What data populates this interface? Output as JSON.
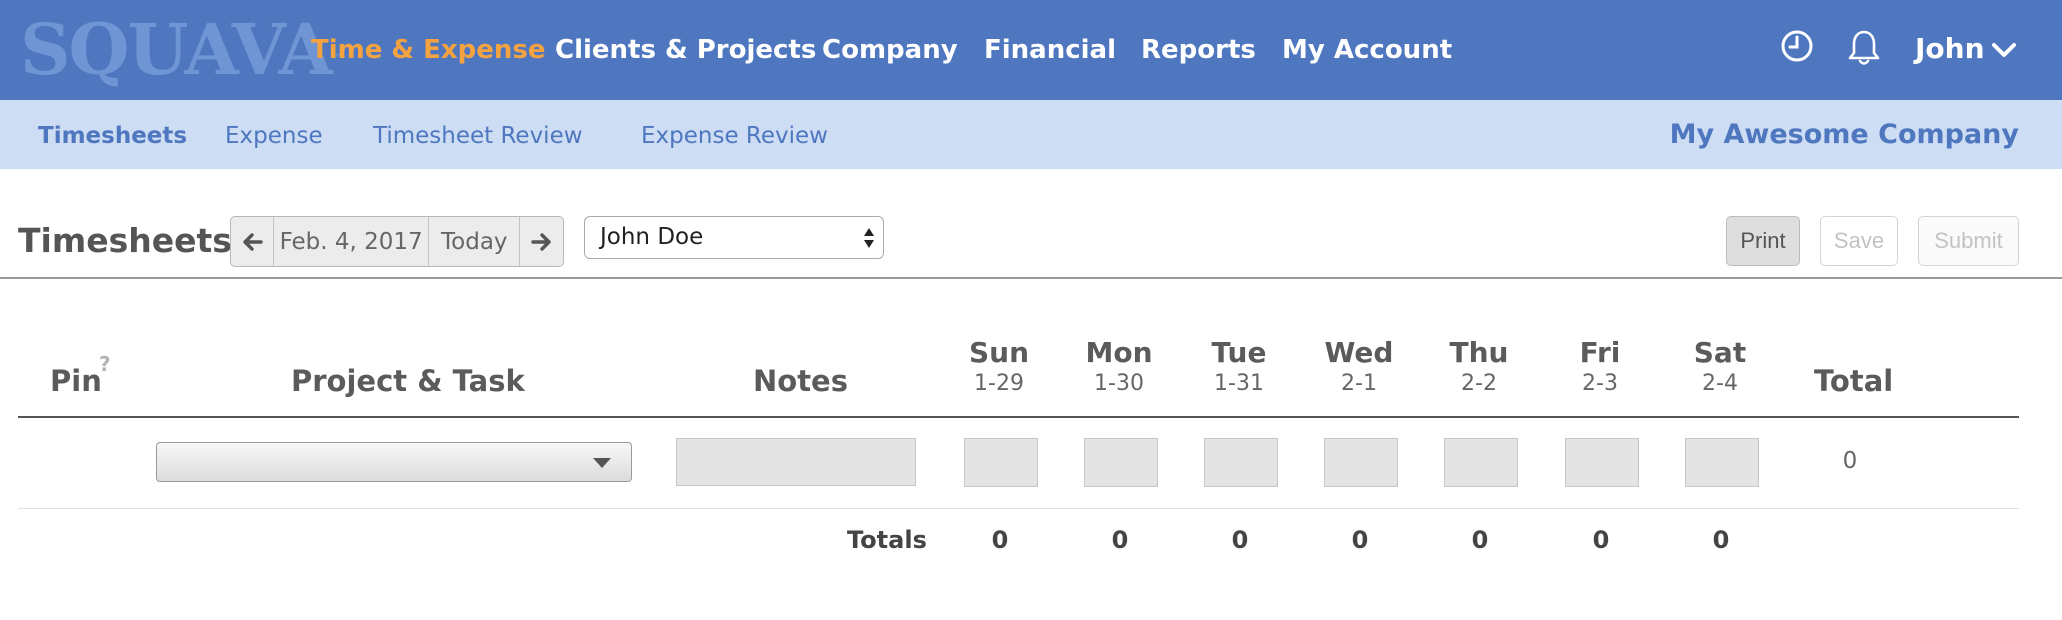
{
  "header": {
    "logo_text": "SQUAVA",
    "logo_tm": "™",
    "nav": [
      {
        "label": "Time & Expense",
        "active": true
      },
      {
        "label": "Clients & Projects"
      },
      {
        "label": "Company"
      },
      {
        "label": "Financial"
      },
      {
        "label": "Reports"
      },
      {
        "label": "My Account"
      }
    ],
    "icons": [
      "clock-icon",
      "bell-icon"
    ],
    "user": "John",
    "accent_color": "#f5a340",
    "bar_color": "#4f77c0"
  },
  "subnav": {
    "items": [
      {
        "label": "Timesheets",
        "active": true
      },
      {
        "label": "Expense"
      },
      {
        "label": "Timesheet Review"
      },
      {
        "label": "Expense Review"
      }
    ],
    "company": "My Awesome Company",
    "bar_color": "#cdddf3"
  },
  "toolbar": {
    "title": "Timesheets",
    "date": "Feb. 4, 2017",
    "today_label": "Today",
    "employee": "John Doe",
    "print_label": "Print",
    "save_label": "Save",
    "submit_label": "Submit"
  },
  "table": {
    "headers": {
      "pin": "Pin",
      "pin_help": "?",
      "project": "Project & Task",
      "notes": "Notes",
      "total": "Total"
    },
    "days": [
      {
        "name": "Sun",
        "date": "1-29"
      },
      {
        "name": "Mon",
        "date": "1-30"
      },
      {
        "name": "Tue",
        "date": "1-31"
      },
      {
        "name": "Wed",
        "date": "2-1"
      },
      {
        "name": "Thu",
        "date": "2-2"
      },
      {
        "name": "Fri",
        "date": "2-3"
      },
      {
        "name": "Sat",
        "date": "2-4"
      }
    ],
    "rows": [
      {
        "project": "",
        "notes": "",
        "hours": [
          "",
          "",
          "",
          "",
          "",
          "",
          ""
        ],
        "total": "0"
      }
    ],
    "totals_label": "Totals",
    "totals": [
      "0",
      "0",
      "0",
      "0",
      "0",
      "0",
      "0"
    ]
  }
}
